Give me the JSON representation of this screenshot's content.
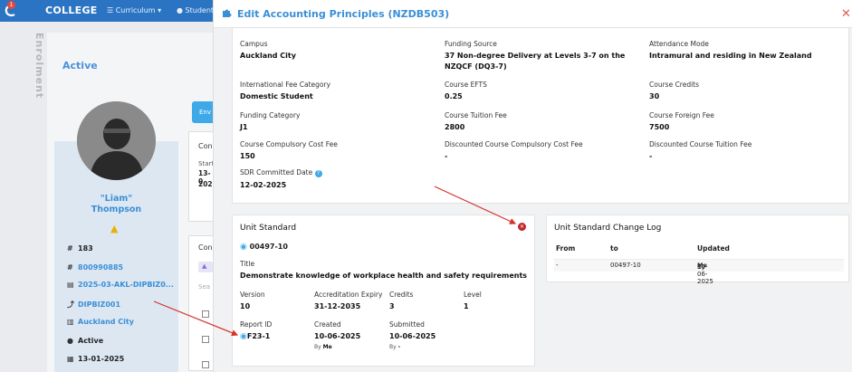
{
  "app": {
    "brand": "COLLEGE",
    "notification_count": "1",
    "nav": {
      "curriculum": "Curriculum",
      "students": "Student"
    }
  },
  "side": {
    "vertical_tab": "Enrolment",
    "status_heading": "Active",
    "tab_partial": "Env",
    "student": {
      "preferred": "\"Liam\"",
      "surname": "Thompson"
    },
    "info": [
      {
        "icon": "hash-icon",
        "glyph": "#",
        "text": "183",
        "link": false
      },
      {
        "icon": "hash-icon",
        "glyph": "#",
        "text": "800990885",
        "link": true
      },
      {
        "icon": "book-icon",
        "glyph": "▤",
        "text": "2025-03-AKL-DIPBIZ0...",
        "link": true
      },
      {
        "icon": "arrow-icon",
        "glyph": "⤴",
        "text": "DIPBIZ001",
        "link": true
      },
      {
        "icon": "building-icon",
        "glyph": "▥",
        "text": "Auckland City",
        "link": true
      },
      {
        "icon": "question-icon",
        "glyph": "●",
        "text": "Active",
        "link": false
      },
      {
        "icon": "calendar-icon",
        "glyph": "▦",
        "text": "13-01-2025",
        "link": false
      }
    ],
    "panel_fragments": {
      "start": "Start",
      "date1": "13-0",
      "date2": "2025",
      "con1": "Con",
      "con2": "Con",
      "sea": "Sea"
    }
  },
  "modal": {
    "title": "Edit Accounting Principles (NZDB503)",
    "fields": {
      "campus_label": "Campus",
      "campus": "Auckland City",
      "funding_source_label": "Funding Source",
      "funding_source": "37 Non-degree Delivery at Levels 3-7 on the NZQCF (DQ3-7)",
      "attendance_label": "Attendance Mode",
      "attendance": "Intramural and residing in New Zealand",
      "intl_fee_label": "International Fee Category",
      "intl_fee": "Domestic Student",
      "efts_label": "Course EFTS",
      "efts": "0.25",
      "credits_label": "Course Credits",
      "credits": "30",
      "funding_cat_label": "Funding Category",
      "funding_cat": "J1",
      "tuition_label": "Course Tuition Fee",
      "tuition": "2800",
      "foreign_label": "Course Foreign Fee",
      "foreign": "7500",
      "compulsory_label": "Course Compulsory Cost Fee",
      "compulsory": "150",
      "disc_compulsory_label": "Discounted Course Compulsory Cost Fee",
      "disc_compulsory": "-",
      "disc_tuition_label": "Discounted Course Tuition Fee",
      "disc_tuition": "-",
      "sdr_label": "SDR Committed Date",
      "sdr": "12-02-2025"
    },
    "unit_standard": {
      "heading": "Unit Standard",
      "code": "00497-10",
      "title_label": "Title",
      "title": "Demonstrate knowledge of workplace health and safety requirements",
      "version_label": "Version",
      "version": "10",
      "expiry_label": "Accreditation Expiry",
      "expiry": "31-12-2035",
      "credits_label": "Credits",
      "credits": "3",
      "level_label": "Level",
      "level": "1",
      "report_label": "Report ID",
      "report": "F23-1",
      "created_label": "Created",
      "created": "10-06-2025",
      "created_by_prefix": "By",
      "created_by": "Me",
      "submitted_label": "Submitted",
      "submitted": "10-06-2025",
      "submitted_by_prefix": "By",
      "submitted_by": "-"
    },
    "change_log": {
      "heading": "Unit Standard Change Log",
      "columns": [
        "From",
        "to",
        "Updated"
      ],
      "rows": [
        {
          "from": "-",
          "to": "00497-10",
          "updated": "10-06-2025",
          "by_prefix": "By",
          "by": "Me"
        }
      ]
    }
  },
  "colors": {
    "primary": "#2b74c4",
    "accent": "#3a8fd6",
    "danger": "#c0262c",
    "arrow": "#d6312c"
  }
}
